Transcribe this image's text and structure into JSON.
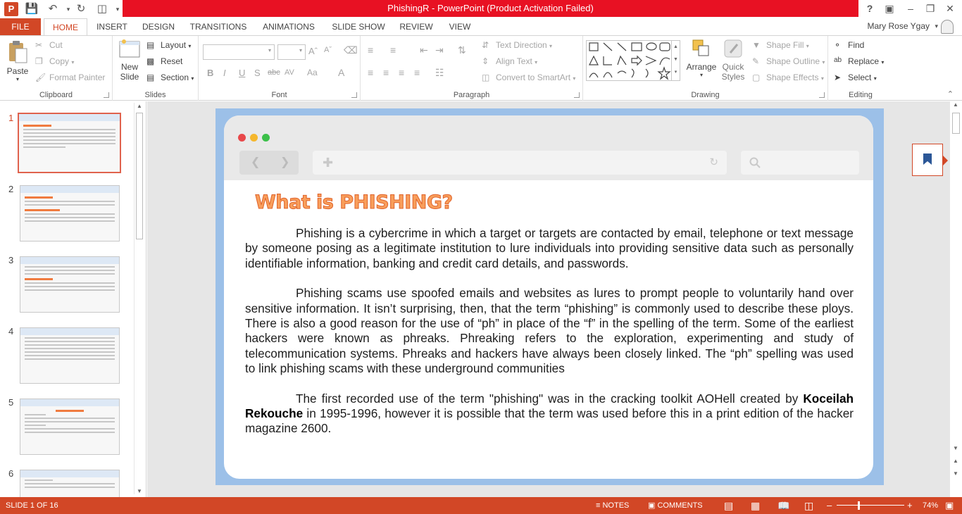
{
  "window": {
    "title": "PhishingR -  PowerPoint (Product Activation Failed)",
    "user": "Mary Rose Ygay",
    "help": "?"
  },
  "tabs": [
    "FILE",
    "HOME",
    "INSERT",
    "DESIGN",
    "TRANSITIONS",
    "ANIMATIONS",
    "SLIDE SHOW",
    "REVIEW",
    "VIEW"
  ],
  "ribbon": {
    "clipboard": {
      "label": "Clipboard",
      "paste": "Paste",
      "cut": "Cut",
      "copy": "Copy",
      "format_painter": "Format Painter"
    },
    "slides": {
      "label": "Slides",
      "new_slide": "New",
      "new_slide_2": "Slide",
      "layout": "Layout",
      "reset": "Reset",
      "section": "Section"
    },
    "font": {
      "label": "Font",
      "bold": "B",
      "italic": "I",
      "underline": "U",
      "shadow": "S",
      "strike": "abc",
      "spacing": "AV",
      "case": "Aa",
      "color": "A"
    },
    "paragraph": {
      "label": "Paragraph",
      "text_direction": "Text Direction",
      "align_text": "Align Text",
      "smartart": "Convert to SmartArt"
    },
    "drawing": {
      "label": "Drawing",
      "arrange": "Arrange",
      "quick_styles": "Quick",
      "quick_styles_2": "Styles",
      "shape_fill": "Shape Fill",
      "shape_outline": "Shape Outline",
      "shape_effects": "Shape Effects"
    },
    "editing": {
      "label": "Editing",
      "find": "Find",
      "replace": "Replace",
      "select": "Select"
    }
  },
  "thumbnails": [
    "1",
    "2",
    "3",
    "4",
    "5",
    "6"
  ],
  "slide": {
    "title": "What is PHISHING?",
    "p1": "Phishing is a cybercrime in which a target or targets are contacted by email, telephone or text message by someone posing as a legitimate institution to lure individuals into providing sensitive data such as personally identifiable information, banking and credit card details, and passwords.",
    "p2": "Phishing scams use spoofed emails and websites as lures to prompt people to voluntarily hand over sensitive information. It isn’t surprising, then, that the term “phishing” is commonly used to describe these ploys. There is also a good reason for the use of “ph” in place of the “f” in the spelling of the term. Some of the earliest hackers were known as phreaks. Phreaking refers to the exploration, experimenting and study of telecommunication systems. Phreaks and hackers have always been closely linked. The “ph” spelling was used to link phishing scams with these underground communities",
    "p3_a": "The first recorded use of the term \"phishing\" was in the cracking toolkit AOHell created by ",
    "p3_bold": "Koceilah Rekouche",
    "p3_b": " in 1995-1996, however it is possible that the term was used before this in a print edition of the hacker magazine 2600."
  },
  "status": {
    "slide_count": "SLIDE 1 OF 16",
    "notes": "NOTES",
    "comments": "COMMENTS",
    "zoom": "74%"
  },
  "colors": {
    "accent": "#d24726",
    "title_bar": "#e81123",
    "slide_bg": "#9cc0e8"
  }
}
